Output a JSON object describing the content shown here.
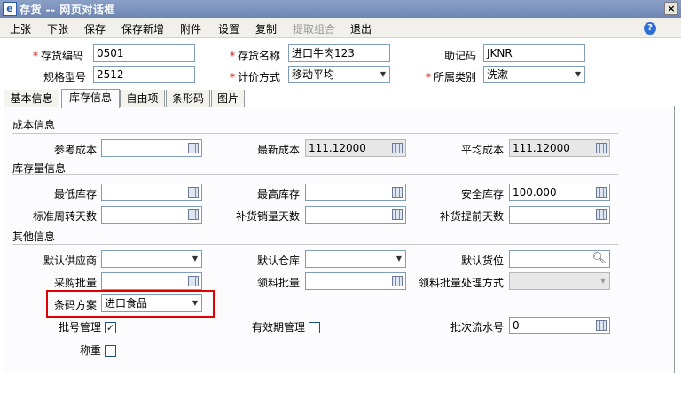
{
  "window": {
    "title": "存货 -- 网页对话框",
    "close_icon": "×",
    "app_icon": "e"
  },
  "menu": {
    "items": [
      "上张",
      "下张",
      "保存",
      "保存新增",
      "附件",
      "设置",
      "复制",
      "提取组合",
      "退出"
    ],
    "disabled": [
      "提取组合"
    ],
    "help_icon": "?"
  },
  "header_form": {
    "code_label": "存货编码",
    "code_value": "0501",
    "name_label": "存货名称",
    "name_value": "进口牛肉123",
    "mnemonic_label": "助记码",
    "mnemonic_value": "JKNR",
    "spec_label": "规格型号",
    "spec_value": "2512",
    "pricing_label": "计价方式",
    "pricing_value": "移动平均",
    "category_label": "所属类别",
    "category_value": "洗漱",
    "required_mark": "*"
  },
  "tabs": [
    "基本信息",
    "库存信息",
    "自由项",
    "条形码",
    "图片"
  ],
  "active_tab": "库存信息",
  "cost": {
    "section": "成本信息",
    "ref_cost_label": "参考成本",
    "ref_cost_value": "",
    "latest_cost_label": "最新成本",
    "latest_cost_value": "111.12000",
    "avg_cost_label": "平均成本",
    "avg_cost_value": "111.12000"
  },
  "stock": {
    "section": "库存量信息",
    "min_label": "最低库存",
    "min_value": "",
    "max_label": "最高库存",
    "max_value": "",
    "safety_label": "安全库存",
    "safety_value": "100.000",
    "turnover_label": "标准周转天数",
    "turnover_value": "",
    "replenish_sales_label": "补货销量天数",
    "replenish_sales_value": "",
    "replenish_lead_label": "补货提前天数",
    "replenish_lead_value": ""
  },
  "other": {
    "section": "其他信息",
    "supplier_label": "默认供应商",
    "supplier_value": "",
    "warehouse_label": "默认仓库",
    "warehouse_value": "",
    "location_label": "默认货位",
    "location_value": "",
    "purchase_batch_label": "采购批量",
    "purchase_batch_value": "",
    "issue_batch_label": "领料批量",
    "issue_batch_value": "",
    "issue_method_label": "领料批量处理方式",
    "issue_method_value": "",
    "barcode_scheme_label": "条码方案",
    "barcode_scheme_value": "进口食品",
    "batch_mgmt_label": "批号管理",
    "batch_mgmt_checked": true,
    "batch_mgmt_mark": "✓",
    "expiry_mgmt_label": "有效期管理",
    "expiry_mgmt_checked": false,
    "batch_serial_label": "批次流水号",
    "batch_serial_value": "0",
    "weigh_label": "称重",
    "weigh_checked": false
  },
  "colors": {
    "highlight": "#e00000",
    "required": "#d00000",
    "title_bar": "#7b92bd"
  }
}
